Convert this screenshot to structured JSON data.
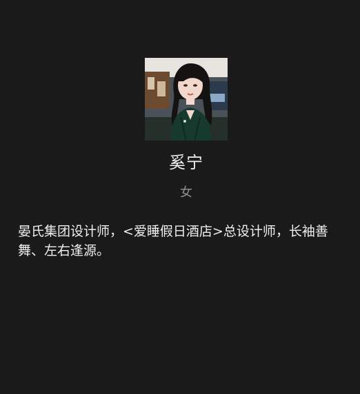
{
  "profile": {
    "avatar_icon": "portrait-avatar-woman",
    "name": "奚宁",
    "gender": "女",
    "bio": "晏氏集团设计师，<爱睡假日酒店>总设计师，长袖善舞、左右逢源。"
  }
}
